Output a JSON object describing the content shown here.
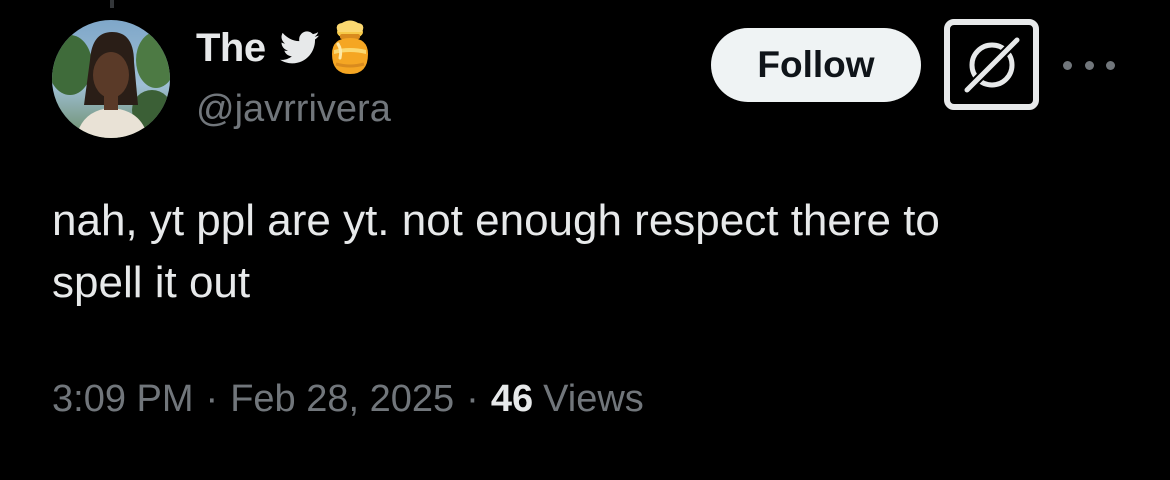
{
  "author": {
    "display_name": "The",
    "handle": "@javrrivera",
    "badges": [
      "twitter-bird-icon",
      "honey-pot-icon"
    ]
  },
  "actions": {
    "follow_label": "Follow",
    "grok_icon": "grok-icon",
    "more_icon": "more-icon"
  },
  "tweet": {
    "text": "nah, yt ppl are yt. not enough respect there to\nspell it out",
    "time": "3:09 PM",
    "date": "Feb 28, 2025",
    "separator": "·",
    "views_count": "46",
    "views_label": "Views"
  },
  "colors": {
    "background": "#000000",
    "primary_text": "#e7e9ea",
    "secondary_text": "#71767b",
    "follow_bg": "#eff3f4",
    "bird_icon": "#e7e9ea",
    "honey_pot": "#f5a623"
  }
}
